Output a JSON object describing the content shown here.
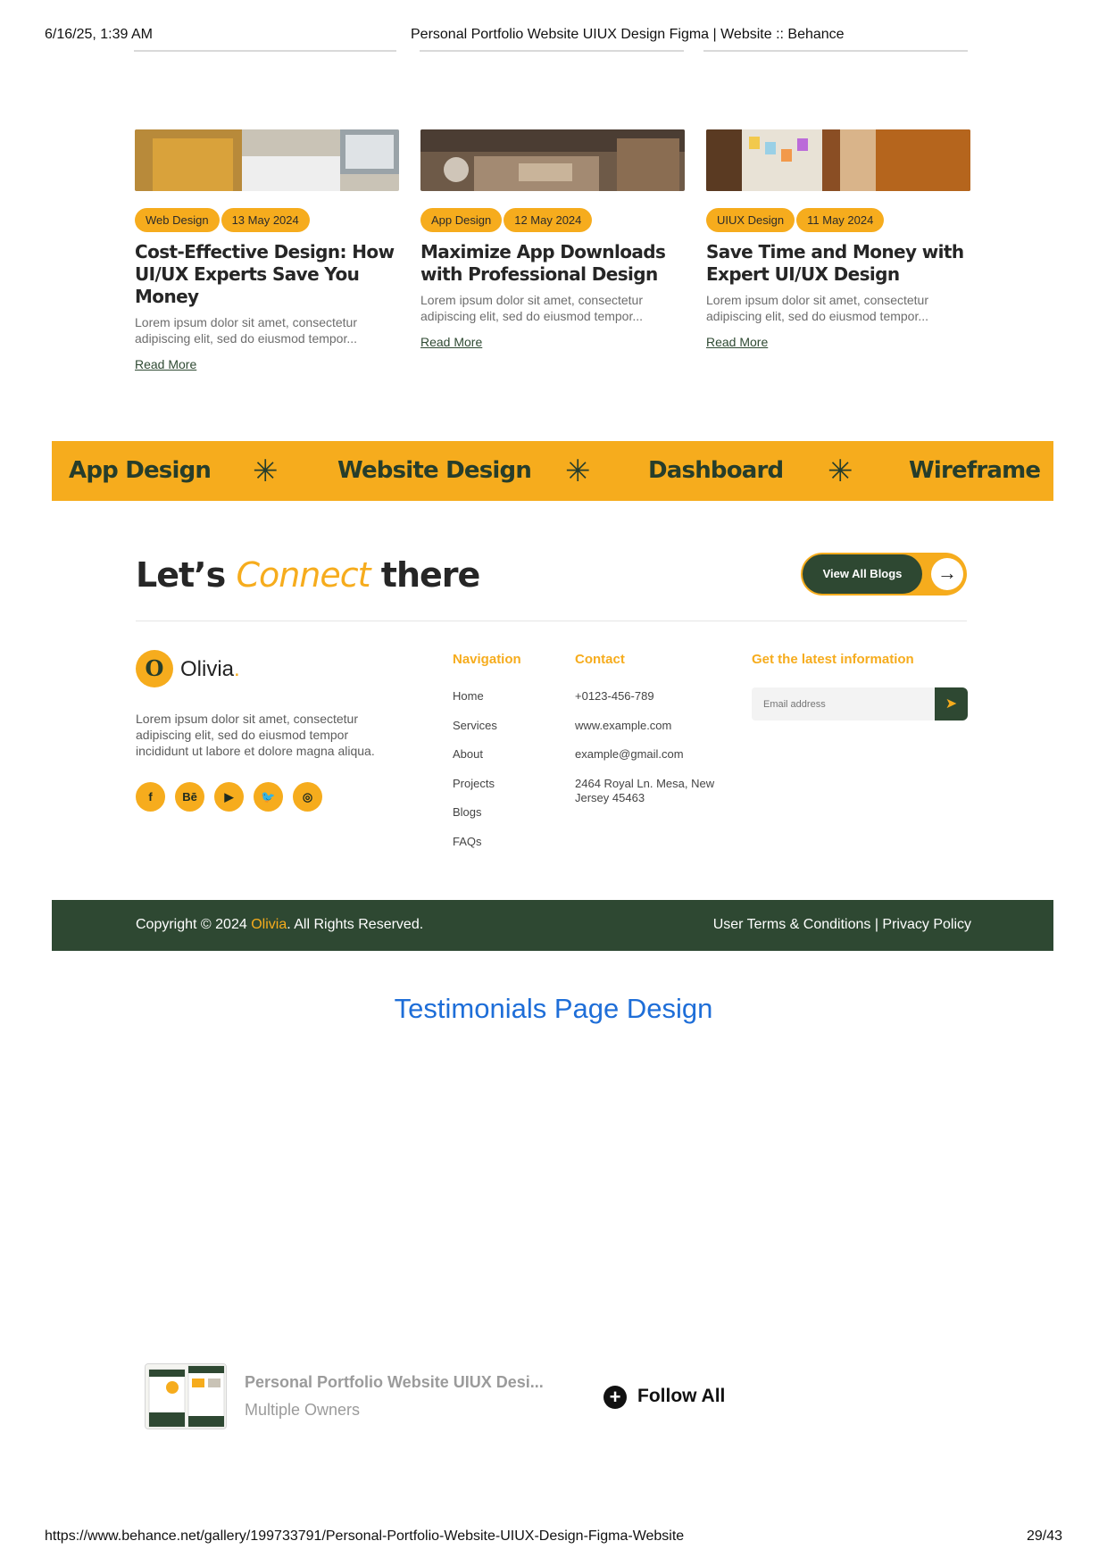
{
  "print_header": {
    "date": "6/16/25, 1:39 AM",
    "title": "Personal Portfolio Website UIUX Design Figma | Website :: Behance"
  },
  "print_footer": {
    "url": "https://www.behance.net/gallery/199733791/Personal-Portfolio-Website-UIUX-Design-Figma-Website",
    "page": "29/43"
  },
  "blog_cards": [
    {
      "category": "Web Design",
      "date": "13 May 2024",
      "title": "Cost-Effective Design: How UI/UX Experts Save You Money",
      "excerpt": "Lorem ipsum dolor sit amet, consectetur adipiscing elit, sed do eiusmod tempor...",
      "link": "Read More"
    },
    {
      "category": "App Design",
      "date": "12 May 2024",
      "title": "Maximize App Downloads with Professional Design",
      "excerpt": "Lorem ipsum dolor sit amet, consectetur adipiscing elit, sed do eiusmod tempor...",
      "link": "Read More"
    },
    {
      "category": "UIUX Design",
      "date": "11 May 2024",
      "title": "Save Time and Money with Expert UI/UX Design",
      "excerpt": "Lorem ipsum dolor sit amet, consectetur adipiscing elit, sed do eiusmod tempor...",
      "link": "Read More"
    }
  ],
  "band": {
    "items": [
      "App Design",
      "Website Design",
      "Dashboard",
      "Wireframe"
    ],
    "separator": "✳"
  },
  "connect": {
    "before": "Let’s ",
    "accent": "Connect",
    "after": " there",
    "button_label": "View All Blogs",
    "arrow": "→"
  },
  "footer": {
    "logo_letter": "O",
    "brand_name": "Olivia",
    "brand_dot": ".",
    "about": "Lorem ipsum dolor sit amet, consectetur adipiscing elit, sed do eiusmod tempor incididunt ut labore et dolore magna aliqua.",
    "socials": [
      {
        "icon": "facebook-icon",
        "glyph": "f"
      },
      {
        "icon": "behance-icon",
        "glyph": "Bē"
      },
      {
        "icon": "youtube-icon",
        "glyph": "▶"
      },
      {
        "icon": "twitter-icon",
        "glyph": "🐦"
      },
      {
        "icon": "instagram-icon",
        "glyph": "◎"
      }
    ],
    "navigation_heading": "Navigation",
    "navigation": [
      "Home",
      "Services",
      "About",
      "Projects",
      "Blogs",
      "FAQs"
    ],
    "contact_heading": "Contact",
    "contact": [
      "+0123-456-789",
      "www.example.com",
      "example@gmail.com",
      "2464 Royal Ln. Mesa, New Jersey 45463"
    ],
    "newsletter_heading": "Get the latest information",
    "newsletter_placeholder": "Email address",
    "send_glyph": "➤"
  },
  "copyright": {
    "prefix": "Copyright © 2024 ",
    "brand": "Olivia",
    "suffix": ". All Rights Reserved.",
    "right": "User Terms & Conditions | Privacy Policy"
  },
  "section_link": "Testimonials Page Design",
  "project": {
    "title": "Personal Portfolio Website UIUX Desi...",
    "owners": "Multiple Owners",
    "follow_label": "Follow All"
  },
  "colors": {
    "accent": "#f6ac1d",
    "dark_green": "#2e4832",
    "link_blue": "#1e6ed8"
  }
}
